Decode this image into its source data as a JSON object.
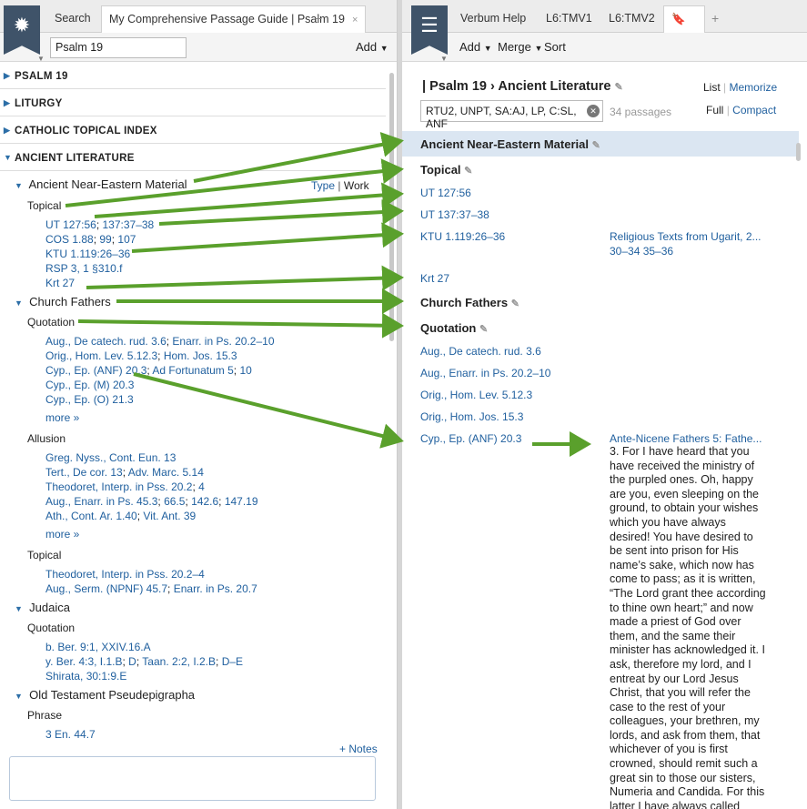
{
  "left": {
    "tabs": [
      "Search",
      "My Comprehensive Passage Guide | Psalm 19"
    ],
    "tab_close": "×",
    "add_tab": "+",
    "reference": "Psalm 19",
    "add_menu": "Add",
    "sections": [
      "PSALM 19",
      "LITURGY",
      "CATHOLIC TOPICAL INDEX",
      "ANCIENT LITERATURE"
    ],
    "group1": {
      "title": "Ancient Near-Eastern Material",
      "type_label": "Type",
      "work_label": "Work",
      "sub": "Topical",
      "items": [
        "UT 127:56",
        "137:37–38",
        "COS 1.88",
        "99",
        "107",
        "KTU 1.119:26–36",
        "RSP 3, 1 §310.f",
        "Krt 27"
      ]
    },
    "group2": {
      "title": "Church Fathers",
      "quotation": "Quotation",
      "q_items": [
        "Aug., De catech. rud. 3.6",
        "Enarr. in Ps. 20.2–10",
        "Orig., Hom. Lev. 5.12.3",
        "Hom. Jos. 15.3",
        "Cyp., Ep. (ANF) 20.3",
        "Ad Fortunatum 5",
        "10",
        "Cyp., Ep. (M) 20.3",
        "Cyp., Ep. (O) 21.3"
      ],
      "more": "more »",
      "allusion": "Allusion",
      "a_items": [
        "Greg. Nyss., Cont. Eun. 13",
        "Tert., De cor. 13",
        "Adv. Marc. 5.14",
        "Theodoret, Interp. in Pss. 20.2",
        "4",
        "Aug., Enarr. in Ps. 45.3",
        "66.5",
        "142.6",
        "147.19",
        "Ath., Cont. Ar. 1.40",
        "Vit. Ant. 39"
      ],
      "topical": "Topical",
      "t_items": [
        "Theodoret, Interp. in Pss. 20.2–4",
        "Aug., Serm. (NPNF) 45.7",
        "Enarr. in Ps. 20.7"
      ]
    },
    "group3": {
      "title": "Judaica",
      "quotation": "Quotation",
      "items": [
        "b. Ber. 9:1, XXIV.16.A",
        "y. Ber. 4:3, I.1.B",
        "D",
        "Taan. 2:2, I.2.B",
        "D–E",
        "Shirata, 30:1:9.E"
      ]
    },
    "group4": {
      "title": "Old Testament Pseudepigrapha",
      "phrase": "Phrase",
      "items": [
        "3 En. 44.7"
      ]
    },
    "notes_link": "+ Notes"
  },
  "right": {
    "tabs": [
      "Verbum Help",
      "L6:TMV1",
      "L6:TMV2"
    ],
    "add_tab": "+",
    "menus": [
      "Add",
      "Merge",
      "Sort"
    ],
    "breadcrumb_bar": "|",
    "breadcrumb_a": "Psalm 19",
    "breadcrumb_sep": "›",
    "breadcrumb_b": "Ancient Literature",
    "view_list": "List",
    "view_memorize": "Memorize",
    "view_full": "Full",
    "view_compact": "Compact",
    "filter": "RTU2, UNPT, SA:AJ, LP, C:SL, ANF",
    "count": "34 passages",
    "heading1": "Ancient Near-Eastern Material",
    "topical": "Topical",
    "ref1": "UT 127:56",
    "ref2": "UT 137:37–38",
    "ref3": "KTU 1.119:26–36",
    "ref3_source": "Religious Texts from Ugarit, 2...",
    "ref3_pages": "30–34 35–36",
    "ref4": "Krt 27",
    "church": "Church Fathers",
    "quotation": "Quotation",
    "q1": "Aug., De catech. rud. 3.6",
    "q2": "Aug., Enarr. in Ps. 20.2–10",
    "q3": "Orig., Hom. Lev. 5.12.3",
    "q4": "Orig., Hom. Jos. 15.3",
    "q5": "Cyp., Ep. (ANF) 20.3",
    "q5_source": "Ante-Nicene Fathers 5: Fathe...",
    "text": "3. For I have heard that you have received the ministry of the purpled ones. Oh, happy are you, even sleeping on the ground, to obtain your wishes which you have always desired! You have desired to be sent into prison for His name’s sake, which now has come to pass; as it is written, “The Lord grant thee according to thine own heart;” and now made a priest of God over them, and the same their minister has acknowledged it. I ask, therefore my lord, and I entreat by our Lord Jesus Christ, that you will refer the case to the rest of your colleagues, your brethren, my lords, and ask from them, that whichever of you is first crowned, should remit such a great sin to those our sisters, Numeria and Candida. For this latter I have always called Etecusa—God is"
  },
  "colors": {
    "link": "#1f5f9e",
    "arrow": "#5aa02c",
    "logo": "#3f5369",
    "highlight": "#dbe6f2"
  },
  "icons": [
    "sun-logo-icon",
    "list-logo-icon",
    "bookmark-icon",
    "pencil-icon",
    "clear-icon"
  ]
}
